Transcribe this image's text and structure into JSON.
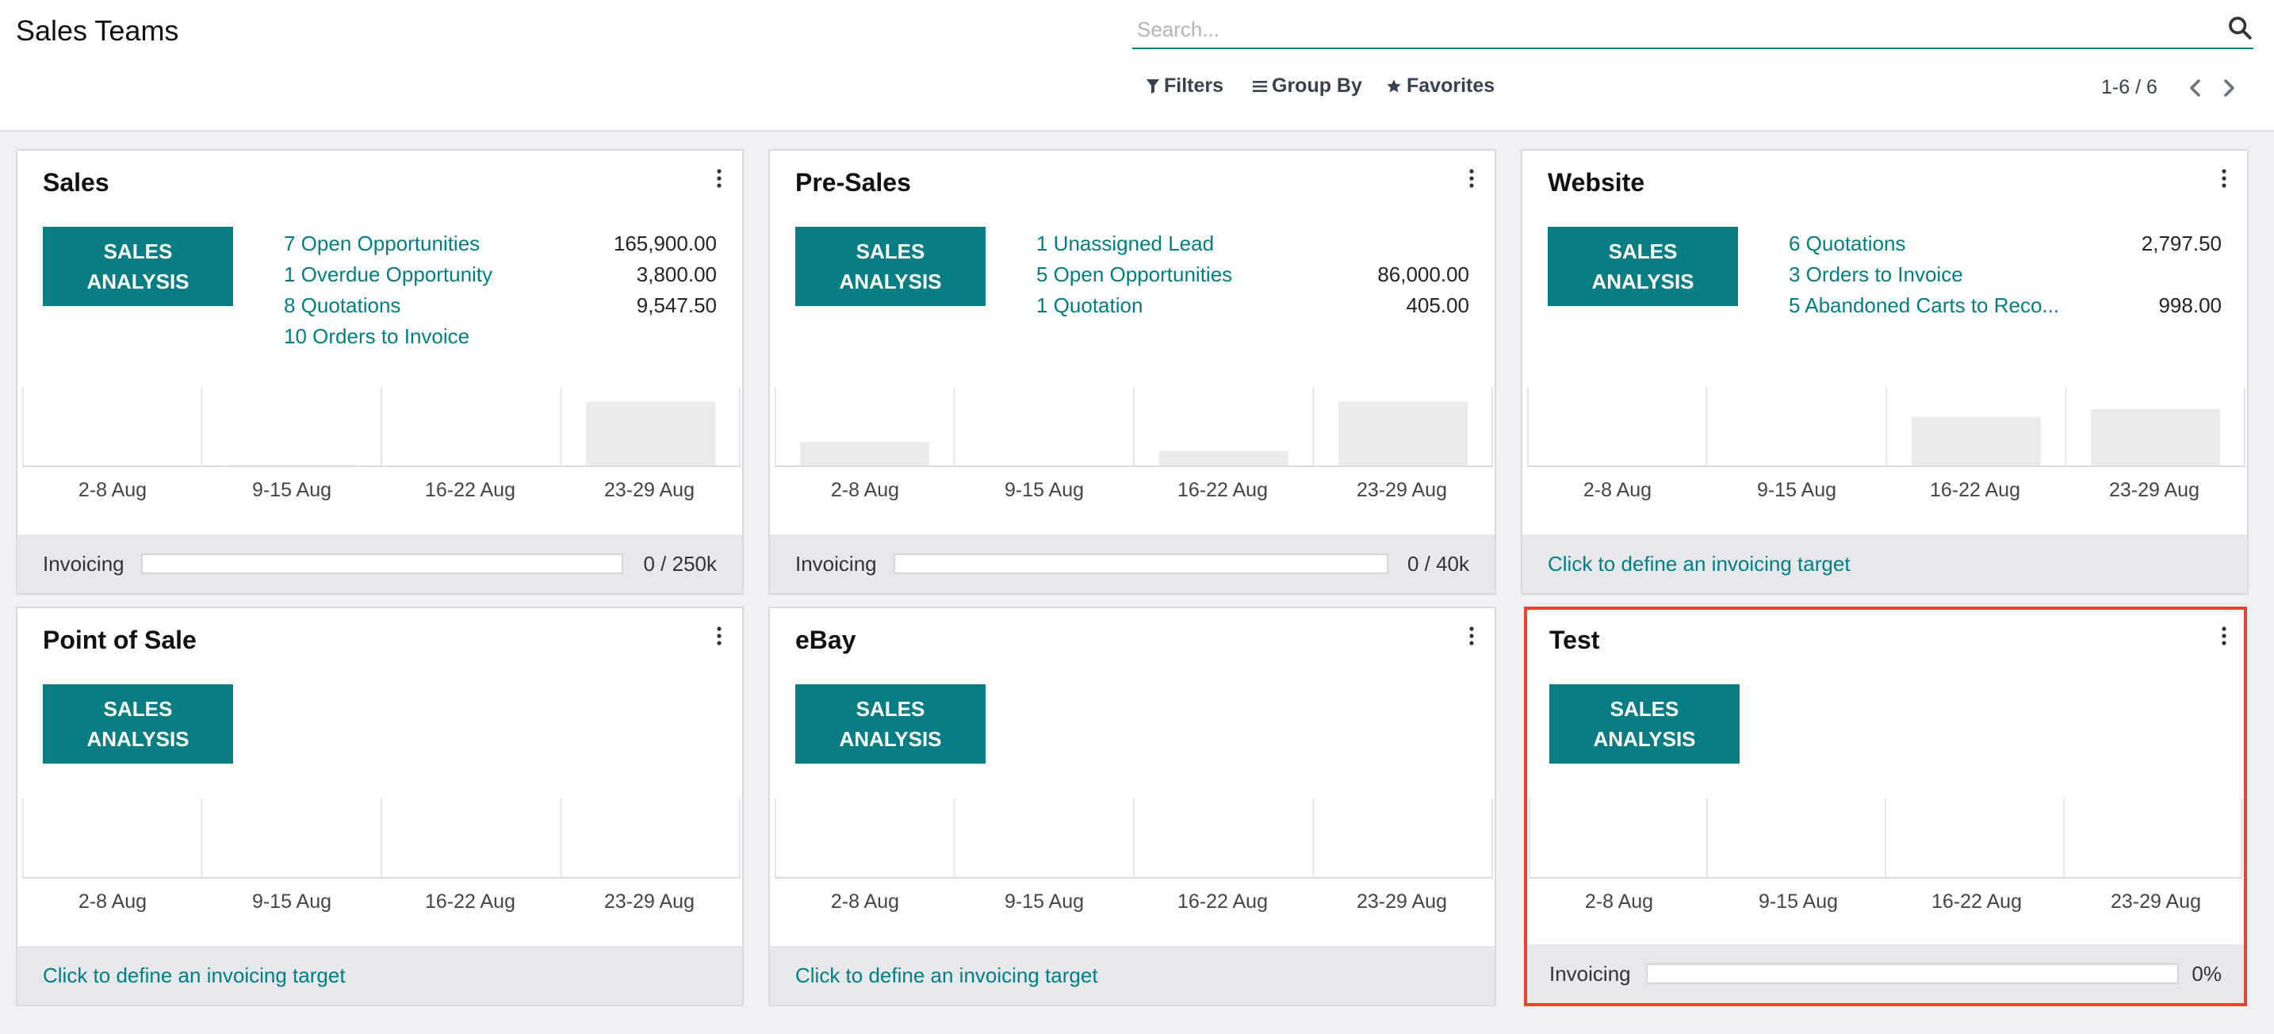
{
  "page": {
    "title": "Sales Teams"
  },
  "search": {
    "placeholder": "Search...",
    "icon": "search-icon"
  },
  "control_panel": {
    "filters_label": "Filters",
    "groupby_label": "Group By",
    "favorites_label": "Favorites"
  },
  "pager": {
    "value": "1-6 / 6"
  },
  "colors": {
    "accent": "#017e84",
    "button": "#087e84",
    "selected_border": "#e8432b"
  },
  "common": {
    "sales_analysis_line1": "SALES",
    "sales_analysis_line2": "ANALYSIS",
    "define_target": "Click to define an invoicing target",
    "invoicing_label": "Invoicing"
  },
  "graph_weeks": [
    "2-8 Aug",
    "9-15 Aug",
    "16-22 Aug",
    "23-29 Aug"
  ],
  "teams": [
    {
      "name": "Sales",
      "stats": [
        {
          "label": "7 Open Opportunities",
          "amount": "165,900.00"
        },
        {
          "label": "1 Overdue Opportunity",
          "amount": "3,800.00"
        },
        {
          "label": "8 Quotations",
          "amount": "9,547.50"
        },
        {
          "label": "10 Orders to Invoice",
          "amount": ""
        }
      ],
      "invoicing_progress": 0.0,
      "invoicing_text": "0 / 250k",
      "graph": [
        0,
        0.02,
        0,
        0.85
      ]
    },
    {
      "name": "Pre-Sales",
      "stats": [
        {
          "label": "1 Unassigned Lead",
          "amount": ""
        },
        {
          "label": "5 Open Opportunities",
          "amount": "86,000.00"
        },
        {
          "label": "1 Quotation",
          "amount": "405.00"
        }
      ],
      "invoicing_progress": 0.0,
      "invoicing_text": "0 / 40k",
      "graph": [
        0.32,
        0,
        0.2,
        0.85
      ]
    },
    {
      "name": "Website",
      "stats": [
        {
          "label": "6 Quotations",
          "amount": "2,797.50"
        },
        {
          "label": "3 Orders to Invoice",
          "amount": ""
        },
        {
          "label": "5 Abandoned Carts to Reco...",
          "amount": "998.00"
        }
      ],
      "graph": [
        0,
        0,
        0.65,
        0.75
      ]
    },
    {
      "name": "Point of Sale",
      "stats": [],
      "graph": [
        0,
        0,
        0,
        0
      ]
    },
    {
      "name": "eBay",
      "stats": [],
      "graph": [
        0,
        0,
        0,
        0
      ]
    },
    {
      "name": "Test",
      "stats": [],
      "invoicing_progress": 0.0,
      "invoicing_text": "0%",
      "graph": [
        0,
        0,
        0,
        0
      ]
    }
  ]
}
